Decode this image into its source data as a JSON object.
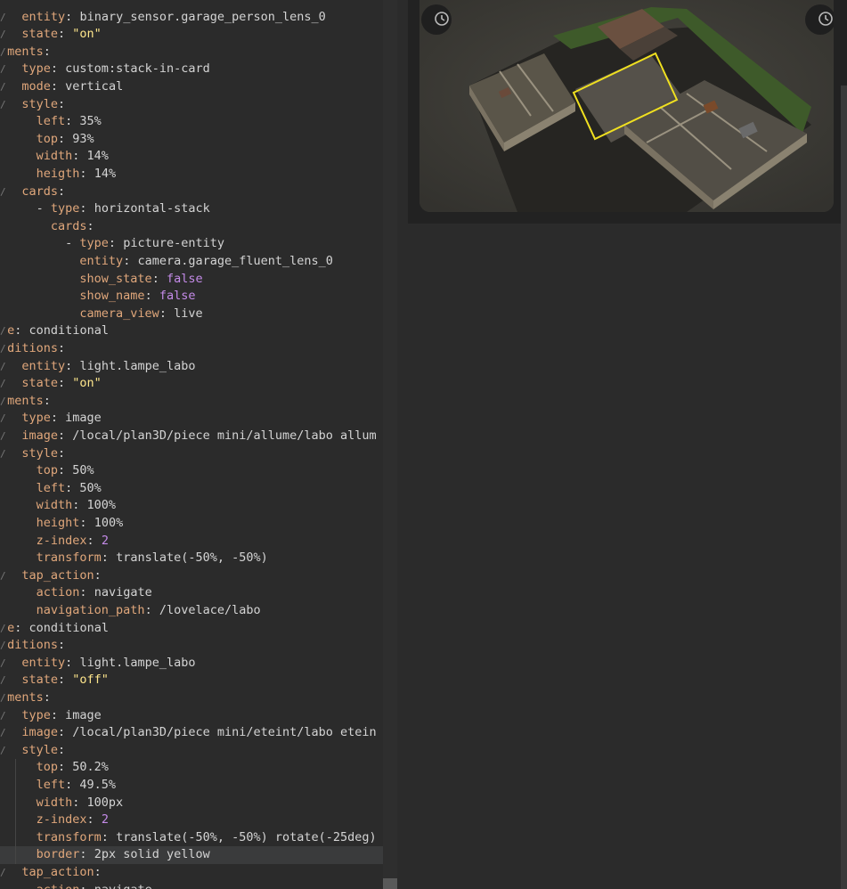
{
  "editor": {
    "lines": [
      {
        "indent": "  ",
        "key": "entity",
        "value": "binary_sensor.garage_person_lens_0",
        "vclass": "p"
      },
      {
        "indent": "  ",
        "key": "state",
        "value": "\"on\"",
        "vclass": "s"
      },
      {
        "indent": "",
        "key": "ments",
        "value": "",
        "vclass": "p"
      },
      {
        "indent": "  ",
        "key": "type",
        "value": "custom:stack-in-card",
        "vclass": "p"
      },
      {
        "indent": "  ",
        "key": "mode",
        "value": "vertical",
        "vclass": "p"
      },
      {
        "indent": "  ",
        "key": "style",
        "value": "",
        "vclass": "p"
      },
      {
        "indent": "    ",
        "key": "left",
        "value": "35%",
        "vclass": "p"
      },
      {
        "indent": "    ",
        "key": "top",
        "value": "93%",
        "vclass": "p"
      },
      {
        "indent": "    ",
        "key": "width",
        "value": "14%",
        "vclass": "p"
      },
      {
        "indent": "    ",
        "key": "heigth",
        "value": "14%",
        "vclass": "p"
      },
      {
        "indent": "  ",
        "key": "cards",
        "value": "",
        "vclass": "p"
      },
      {
        "indent": "    - ",
        "key": "type",
        "value": "horizontal-stack",
        "vclass": "p"
      },
      {
        "indent": "      ",
        "key": "cards",
        "value": "",
        "vclass": "p"
      },
      {
        "indent": "        - ",
        "key": "type",
        "value": "picture-entity",
        "vclass": "p"
      },
      {
        "indent": "          ",
        "key": "entity",
        "value": "camera.garage_fluent_lens_0",
        "vclass": "p"
      },
      {
        "indent": "          ",
        "key": "show_state",
        "value": "false",
        "vclass": "n"
      },
      {
        "indent": "          ",
        "key": "show_name",
        "value": "false",
        "vclass": "n"
      },
      {
        "indent": "          ",
        "key": "camera_view",
        "value": "live",
        "vclass": "p"
      },
      {
        "indent": "",
        "key": "e",
        "value": "conditional",
        "vclass": "p"
      },
      {
        "indent": "",
        "key": "ditions",
        "value": "",
        "vclass": "p"
      },
      {
        "indent": "  ",
        "key": "entity",
        "value": "light.lampe_labo",
        "vclass": "p"
      },
      {
        "indent": "  ",
        "key": "state",
        "value": "\"on\"",
        "vclass": "s"
      },
      {
        "indent": "",
        "key": "ments",
        "value": "",
        "vclass": "p"
      },
      {
        "indent": "  ",
        "key": "type",
        "value": "image",
        "vclass": "p"
      },
      {
        "indent": "  ",
        "key": "image",
        "value": "/local/plan3D/piece mini/allume/labo allum",
        "vclass": "p"
      },
      {
        "indent": "  ",
        "key": "style",
        "value": "",
        "vclass": "p"
      },
      {
        "indent": "    ",
        "key": "top",
        "value": "50%",
        "vclass": "p"
      },
      {
        "indent": "    ",
        "key": "left",
        "value": "50%",
        "vclass": "p"
      },
      {
        "indent": "    ",
        "key": "width",
        "value": "100%",
        "vclass": "p"
      },
      {
        "indent": "    ",
        "key": "height",
        "value": "100%",
        "vclass": "p"
      },
      {
        "indent": "    ",
        "key": "z-index",
        "value": "2",
        "vclass": "n"
      },
      {
        "indent": "    ",
        "key": "transform",
        "value": "translate(-50%, -50%)",
        "vclass": "p"
      },
      {
        "indent": "  ",
        "key": "tap_action",
        "value": "",
        "vclass": "p"
      },
      {
        "indent": "    ",
        "key": "action",
        "value": "navigate",
        "vclass": "p"
      },
      {
        "indent": "    ",
        "key": "navigation_path",
        "value": "/lovelace/labo",
        "vclass": "p"
      },
      {
        "indent": "",
        "key": "e",
        "value": "conditional",
        "vclass": "p"
      },
      {
        "indent": "",
        "key": "ditions",
        "value": "",
        "vclass": "p"
      },
      {
        "indent": "  ",
        "key": "entity",
        "value": "light.lampe_labo",
        "vclass": "p"
      },
      {
        "indent": "  ",
        "key": "state",
        "value": "\"off\"",
        "vclass": "s"
      },
      {
        "indent": "",
        "key": "ments",
        "value": "",
        "vclass": "p"
      },
      {
        "indent": "  ",
        "key": "type",
        "value": "image",
        "vclass": "p"
      },
      {
        "indent": "  ",
        "key": "image",
        "value": "/local/plan3D/piece mini/eteint/labo etein",
        "vclass": "p"
      },
      {
        "indent": "  ",
        "key": "style",
        "value": "",
        "vclass": "p"
      },
      {
        "indent": "    ",
        "key": "top",
        "value": "50.2%",
        "vclass": "p"
      },
      {
        "indent": "    ",
        "key": "left",
        "value": "49.5%",
        "vclass": "p"
      },
      {
        "indent": "    ",
        "key": "width",
        "value": "100px",
        "vclass": "p"
      },
      {
        "indent": "    ",
        "key": "z-index",
        "value": "2",
        "vclass": "n"
      },
      {
        "indent": "    ",
        "key": "transform",
        "value": "translate(-50%, -50%) rotate(-25deg)",
        "vclass": "p"
      },
      {
        "indent": "    ",
        "key": "border",
        "value": "2px solid yellow",
        "vclass": "p"
      },
      {
        "indent": "  ",
        "key": "tap_action",
        "value": "",
        "vclass": "p"
      },
      {
        "indent": "    ",
        "key": "action",
        "value": "navigate",
        "vclass": "p"
      }
    ],
    "active_line_index": 48,
    "fold_marker": "/",
    "colors": {
      "key": "#e0a77b",
      "string": "#ffe68c",
      "number": "#c48be8",
      "text": "#d4d4d4",
      "bg": "#2b2b2b"
    }
  },
  "preview": {
    "history_icon_left": "history-icon",
    "history_icon_right": "history-icon",
    "highlight_color": "#f0e020",
    "floorplan_image": "3D house floor plan render"
  }
}
